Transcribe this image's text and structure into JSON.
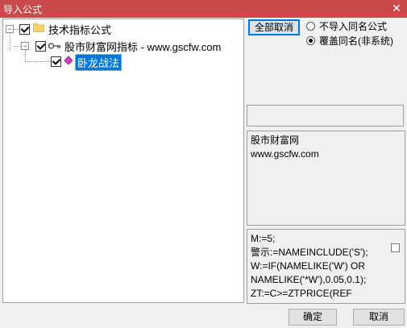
{
  "window": {
    "title": "导入公式",
    "close_glyph": "✕"
  },
  "tree": {
    "root": {
      "label": "技术指标公式",
      "expander": "−",
      "checked": true,
      "icon": "folder-icon"
    },
    "group": {
      "label": "股市财富网指标 - www.gscfw.com",
      "expander": "−",
      "checked": true,
      "icon": "key-icon"
    },
    "item": {
      "label": "卧龙战法",
      "checked": true,
      "selected": true,
      "icon": "formula-icon"
    }
  },
  "options": {
    "cancel_all_label": "全部取消",
    "radio_options": [
      {
        "label": "不导入同名公式",
        "selected": false
      },
      {
        "label": "覆盖同名(非系统)",
        "selected": true
      }
    ]
  },
  "description": {
    "line1": "股市财富网",
    "line2": "www.gscfw.com"
  },
  "formula_lines": [
    "M:=5;",
    "警示:=NAMEINCLUDE('S');",
    "W:=IF(NAMELIKE('W') OR",
    "NAMELIKE('*W'),0.05,0.1);",
    "ZT:=C>=ZTPRICE(REF"
  ],
  "footer": {
    "ok_label": "确定",
    "cancel_label": "取消"
  },
  "colors": {
    "titlebar": "#c94a4a",
    "selection": "#0078d7"
  }
}
